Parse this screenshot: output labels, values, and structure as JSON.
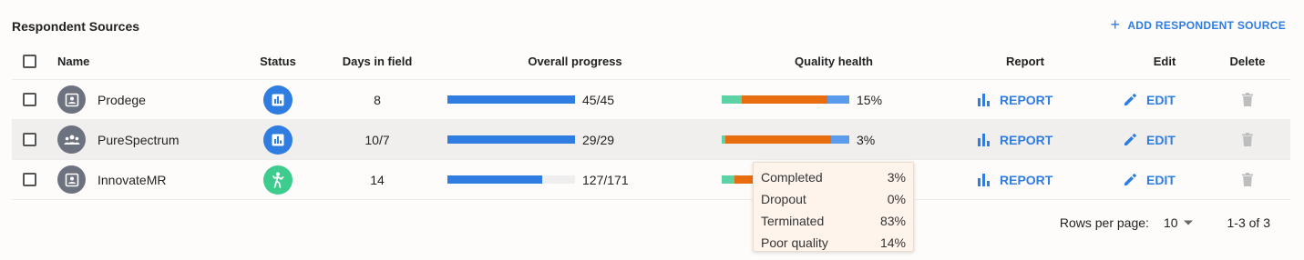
{
  "title": "Respondent Sources",
  "add_button": {
    "icon": "plus-icon",
    "label": "ADD RESPONDENT SOURCE"
  },
  "columns": {
    "name": "Name",
    "status": "Status",
    "days": "Days in field",
    "progress": "Overall progress",
    "quality": "Quality health",
    "report": "Report",
    "edit": "Edit",
    "delete": "Delete"
  },
  "rows": [
    {
      "name": "Prodege",
      "avatar_icon": "person-card-icon",
      "status_icon": "bar-chart-icon",
      "status_color": "#2f7de1",
      "days": "8",
      "progress_text": "45/45",
      "progress_fraction": 1.0,
      "quality_segments": [
        {
          "label": "Completed",
          "fraction": 0.16,
          "color": "#5dd3a5"
        },
        {
          "label": "Terminated",
          "fraction": 0.67,
          "color": "#e86d0f"
        },
        {
          "label": "Poor quality",
          "fraction": 0.17,
          "color": "#5b9bec"
        }
      ],
      "quality_text": "15%",
      "report_label": "REPORT",
      "edit_label": "EDIT"
    },
    {
      "name": "PureSpectrum",
      "avatar_icon": "group-icon",
      "status_icon": "bar-chart-icon",
      "status_color": "#2f7de1",
      "days": "10/7",
      "progress_text": "29/29",
      "progress_fraction": 1.0,
      "quality_segments": [
        {
          "label": "Completed",
          "fraction": 0.03,
          "color": "#5dd3a5"
        },
        {
          "label": "Terminated",
          "fraction": 0.83,
          "color": "#e86d0f"
        },
        {
          "label": "Poor quality",
          "fraction": 0.14,
          "color": "#5b9bec"
        }
      ],
      "quality_text": "3%",
      "report_label": "REPORT",
      "edit_label": "EDIT"
    },
    {
      "name": "InnovateMR",
      "avatar_icon": "person-card-icon",
      "status_icon": "running-person-icon",
      "status_color": "#3dcc8e",
      "days": "14",
      "progress_text": "127/171",
      "progress_fraction": 0.74,
      "quality_segments": [
        {
          "label": "Completed",
          "fraction": 0.1,
          "color": "#5dd3a5"
        },
        {
          "label": "Terminated",
          "fraction": 0.8,
          "color": "#e86d0f"
        },
        {
          "label": "Poor quality",
          "fraction": 0.1,
          "color": "#5b9bec"
        }
      ],
      "quality_text": "",
      "report_label": "REPORT",
      "edit_label": "EDIT"
    }
  ],
  "tooltip": [
    {
      "label": "Completed",
      "value": "3%"
    },
    {
      "label": "Dropout",
      "value": "0%"
    },
    {
      "label": "Terminated",
      "value": "83%"
    },
    {
      "label": "Poor quality",
      "value": "14%"
    }
  ],
  "footer": {
    "rows_per_page_label": "Rows per page:",
    "rows_per_page_value": "10",
    "range": "1-3 of 3"
  }
}
